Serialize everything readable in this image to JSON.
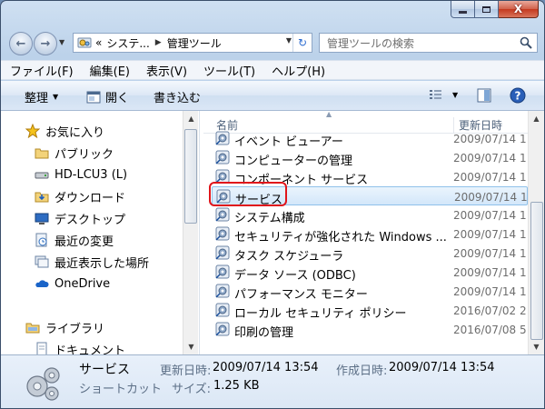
{
  "window": {
    "caption": {
      "minimize": "",
      "maximize": "",
      "close": "X"
    }
  },
  "address": {
    "overflow": "«",
    "crumbs": [
      "システ...",
      "管理ツール"
    ]
  },
  "search": {
    "placeholder": "管理ツールの検索"
  },
  "menu": [
    "ファイル(F)",
    "編集(E)",
    "表示(V)",
    "ツール(T)",
    "ヘルプ(H)"
  ],
  "toolbar": {
    "organize": "整理",
    "open": "開く",
    "burn": "書き込む"
  },
  "nav_pane": {
    "items": [
      {
        "label": "お気に入り",
        "icon": "star-icon"
      },
      {
        "label": "パブリック",
        "icon": "folder-icon"
      },
      {
        "label": "HD-LCU3 (L)",
        "icon": "drive-icon"
      },
      {
        "label": "ダウンロード",
        "icon": "download-folder-icon"
      },
      {
        "label": "デスクトップ",
        "icon": "desktop-icon"
      },
      {
        "label": "最近の変更",
        "icon": "recent-changes-icon"
      },
      {
        "label": "最近表示した場所",
        "icon": "recent-places-icon"
      },
      {
        "label": "OneDrive",
        "icon": "onedrive-icon"
      },
      {
        "label": "ライブラリ",
        "icon": "library-icon"
      },
      {
        "label": "ドキュメント",
        "icon": "documents-icon"
      }
    ]
  },
  "columns": {
    "name": "名前",
    "date": "更新日時"
  },
  "files": [
    {
      "name": "イベント ビューアー",
      "date": "2009/07/14 1"
    },
    {
      "name": "コンピューターの管理",
      "date": "2009/07/14 1"
    },
    {
      "name": "コンポーネント サービス",
      "date": "2009/07/14 1"
    },
    {
      "name": "サービス",
      "date": "2009/07/14 1",
      "selected": true
    },
    {
      "name": "システム構成",
      "date": "2009/07/14 1"
    },
    {
      "name": "セキュリティが強化された Windows ...",
      "date": "2009/07/14 1"
    },
    {
      "name": "タスク スケジューラ",
      "date": "2009/07/14 1"
    },
    {
      "name": "データ ソース (ODBC)",
      "date": "2009/07/14 1"
    },
    {
      "name": "パフォーマンス モニター",
      "date": "2009/07/14 1"
    },
    {
      "name": "ローカル セキュリティ ポリシー",
      "date": "2016/07/02 2"
    },
    {
      "name": "印刷の管理",
      "date": "2016/07/08 5"
    }
  ],
  "details": {
    "name": "サービス",
    "type": "ショートカット",
    "modified_label": "更新日時:",
    "modified_value": "2009/07/14 13:54",
    "created_label": "作成日時:",
    "created_value": "2009/07/14 13:54",
    "size_label": "サイズ:",
    "size_value": "1.25 KB"
  },
  "colors": {
    "highlight": "#e0151b",
    "selection": "#d3e7fa"
  }
}
